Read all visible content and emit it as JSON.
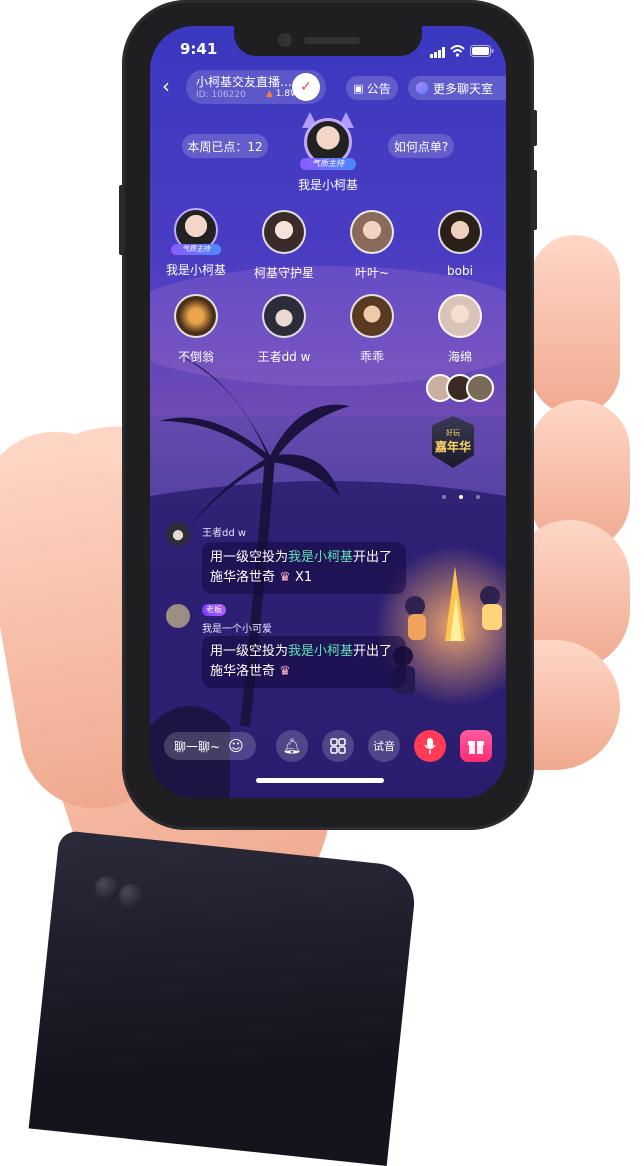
{
  "status_bar": {
    "time": "9:41"
  },
  "header": {
    "room_title": "小柯基交友直播…",
    "room_id_label": "ID:",
    "room_id": "106220",
    "heat": "1.8W",
    "notice_label": "公告",
    "more_rooms_label": "更多聊天室"
  },
  "host": {
    "weekly_points_label": "本周已点：12",
    "how_to_order_label": "如何点单?",
    "name": "我是小柯基",
    "badge": "气质主持"
  },
  "seats": [
    {
      "name": "我是小柯基",
      "badge": "气质主持"
    },
    {
      "name": "柯基守护星"
    },
    {
      "name": "叶叶~"
    },
    {
      "name": "bobi"
    },
    {
      "name": "不倒翁"
    },
    {
      "name": "王者dd w"
    },
    {
      "name": "乖乖"
    },
    {
      "name": "海绵"
    }
  ],
  "event_banner": {
    "line1": "好玩",
    "line2": "嘉年华"
  },
  "chat": [
    {
      "sender": "王者dd w",
      "line1_pre": "用一级空投为",
      "line1_hl": "我是小柯基",
      "line1_post": "开出了",
      "line2": "施华洛世奇",
      "suffix": "X1"
    },
    {
      "sender": "我是一个小可爱",
      "role_badge": "老板",
      "line1_pre": "用一级空投为",
      "line1_hl": "我是小柯基",
      "line1_post": "开出了",
      "line2": "施华洛世奇",
      "suffix": ""
    }
  ],
  "toolbar": {
    "chat_placeholder": "聊一聊~",
    "audition_label": "试音"
  },
  "colors": {
    "accent_green": "#5fe2b6",
    "mic_red": "#ff3b57",
    "gift_pink": "#ff3a8c"
  }
}
